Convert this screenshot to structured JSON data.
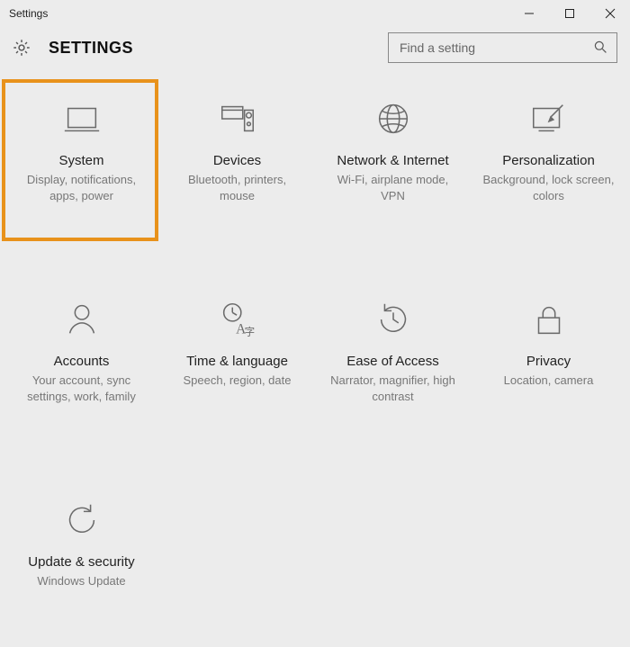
{
  "window": {
    "title": "Settings"
  },
  "header": {
    "page_title": "SETTINGS"
  },
  "search": {
    "placeholder": "Find a setting"
  },
  "tiles": [
    {
      "title": "System",
      "desc": "Display, notifications, apps, power"
    },
    {
      "title": "Devices",
      "desc": "Bluetooth, printers, mouse"
    },
    {
      "title": "Network & Internet",
      "desc": "Wi-Fi, airplane mode, VPN"
    },
    {
      "title": "Personalization",
      "desc": "Background, lock screen, colors"
    },
    {
      "title": "Accounts",
      "desc": "Your account, sync settings, work, family"
    },
    {
      "title": "Time & language",
      "desc": "Speech, region, date"
    },
    {
      "title": "Ease of Access",
      "desc": "Narrator, magnifier, high contrast"
    },
    {
      "title": "Privacy",
      "desc": "Location, camera"
    },
    {
      "title": "Update & security",
      "desc": "Windows Update"
    }
  ],
  "highlight": {
    "tile_index": 0
  }
}
